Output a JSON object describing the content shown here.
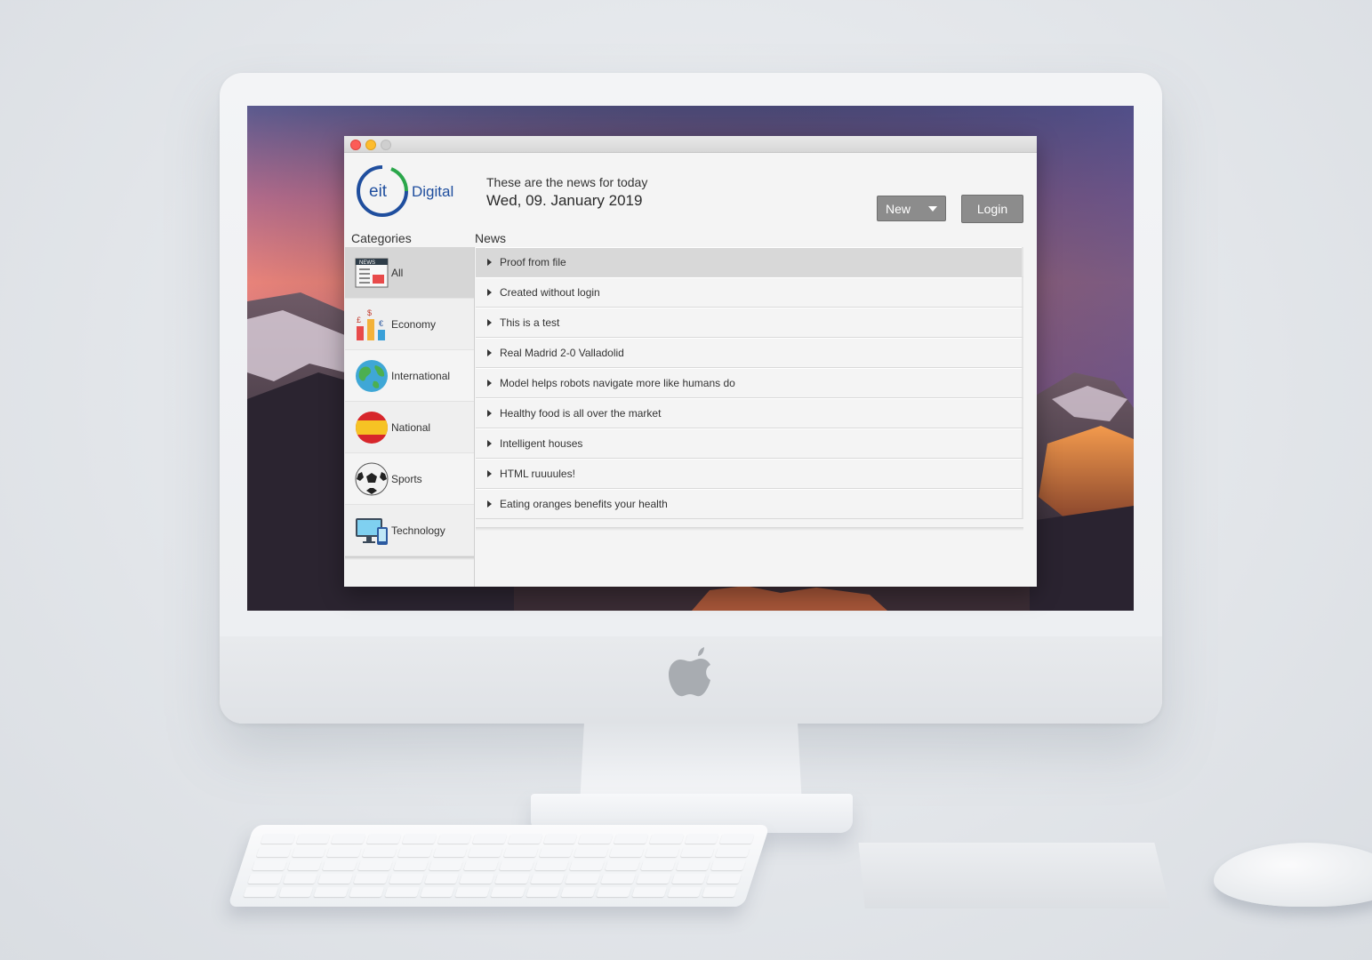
{
  "app": {
    "brand_mark": "eit",
    "brand_name": "Digital",
    "headline": "These are the news for today",
    "date": "Wed, 09. January 2019"
  },
  "toolbar": {
    "new_label": "New",
    "login_label": "Login"
  },
  "sidebar": {
    "heading": "Categories",
    "items": [
      {
        "label": "All",
        "icon": "newspaper-icon",
        "selected": true
      },
      {
        "label": "Economy",
        "icon": "currency-chart-icon",
        "selected": false
      },
      {
        "label": "International",
        "icon": "globe-icon",
        "selected": false
      },
      {
        "label": "National",
        "icon": "spain-flag-icon",
        "selected": false
      },
      {
        "label": "Sports",
        "icon": "soccer-ball-icon",
        "selected": false
      },
      {
        "label": "Technology",
        "icon": "devices-icon",
        "selected": false
      }
    ]
  },
  "news": {
    "heading": "News",
    "items": [
      {
        "title": "Proof from file",
        "selected": true
      },
      {
        "title": "Created without login",
        "selected": false
      },
      {
        "title": "This is a test",
        "selected": false
      },
      {
        "title": "Real Madrid 2-0 Valladolid",
        "selected": false
      },
      {
        "title": "Model helps robots navigate more like humans do",
        "selected": false
      },
      {
        "title": "Healthy food is all over the market",
        "selected": false
      },
      {
        "title": "Intelligent houses",
        "selected": false
      },
      {
        "title": "HTML ruuuules!",
        "selected": false
      },
      {
        "title": "Eating oranges benefits your health",
        "selected": false
      }
    ]
  },
  "colors": {
    "brand_blue": "#1f4e9e",
    "brand_green": "#2aa64a",
    "button_gray": "#8c8c8c",
    "selected_row": "#d8d8d8"
  }
}
